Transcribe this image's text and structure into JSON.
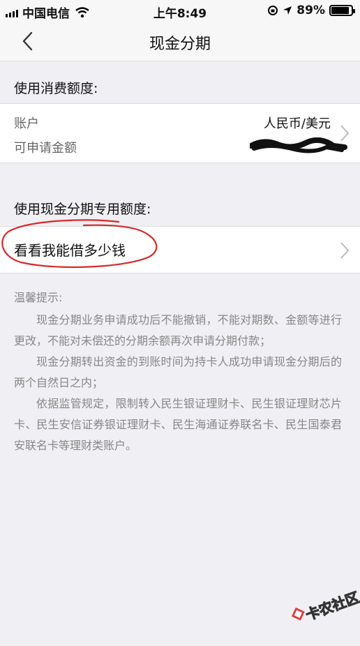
{
  "status_bar": {
    "carrier": "中国电信",
    "time": "上午8:49",
    "battery_percent": "89%",
    "battery_level": 0.89
  },
  "nav": {
    "title": "现金分期"
  },
  "section1": {
    "label": "使用消费额度:",
    "account_label": "账户",
    "account_value": "人民币/美元",
    "available_label": "可申请金额"
  },
  "section2": {
    "label": "使用现金分期专用额度:",
    "borrow_label": "看看我能借多少钱"
  },
  "notice": {
    "title": "温馨提示:",
    "paragraphs": [
      "现金分期业务申请成功后不能撤销，不能对期数、金额等进行更改，不能对未偿还的分期余额再次申请分期付款；",
      "现金分期转出资金的到账时间为持卡人成功申请现金分期后的两个自然日之内；",
      "依据监管规定，限制转入民生银证理财卡、民生银证理财芯片卡、民生安信证券银证理财卡、民生海通证券联名卡、民生国泰君安联名卡等理财类账户。"
    ]
  },
  "watermark": {
    "text": "卡农社区"
  }
}
